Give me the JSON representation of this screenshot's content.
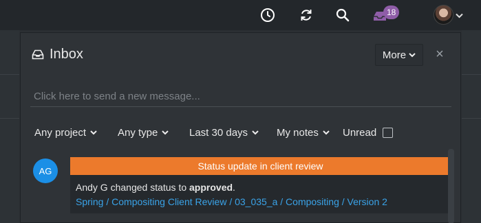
{
  "topbar": {
    "icons": [
      "clock-icon",
      "sync-icon",
      "search-icon",
      "inbox-icon"
    ],
    "inbox_count": "18"
  },
  "panel": {
    "title": "Inbox",
    "more_label": "More",
    "close_glyph": "×",
    "message_placeholder": "Click here to send a new message..."
  },
  "filters": {
    "project": "Any project",
    "type": "Any type",
    "period": "Last 30 days",
    "notes": "My notes",
    "unread": "Unread"
  },
  "notification": {
    "avatar_initials": "AG",
    "header": "Status update in client review",
    "author": "Andy G",
    "text_prefix": "changed status to",
    "status": "approved",
    "text_suffix": ".",
    "link": "Spring / Compositing Client Review / 03_035_a / Compositing / Version 2"
  },
  "colors": {
    "accent_orange": "#ec7a2c",
    "link_blue": "#3aa3e8",
    "badge_purple": "#8f5da8",
    "avatar_blue": "#1b8fe6"
  }
}
